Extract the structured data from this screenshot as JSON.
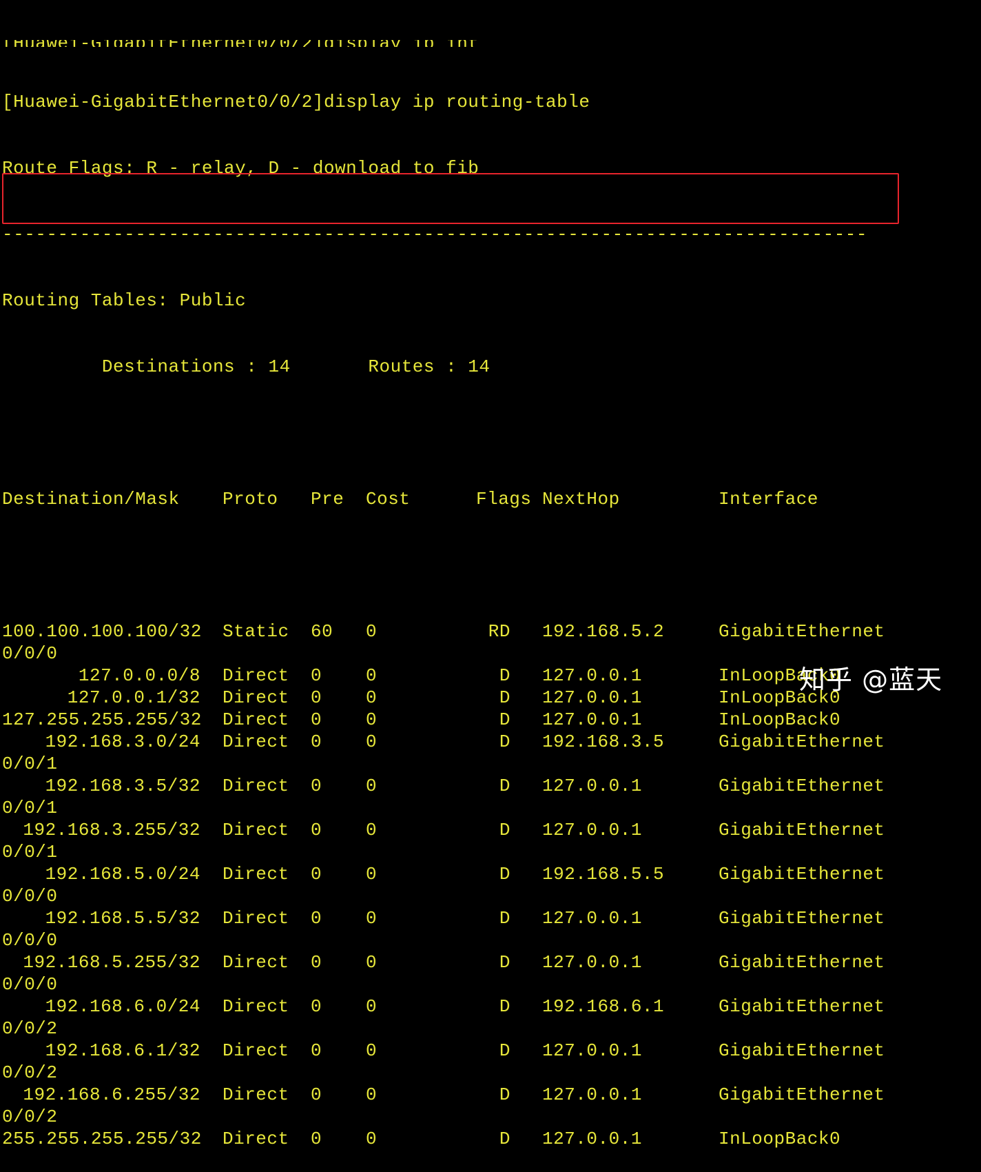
{
  "terminal": {
    "cutoff_line": "[Huawei-GigabitEthernet0/0/2]display ip int",
    "command_line": "[Huawei-GigabitEthernet0/0/2]display ip routing-table",
    "flags_legend": "Route Flags: R - relay, D - download to fib",
    "separator": "------------------------------------------------------------------------------",
    "routing_tables_label": "Routing Tables: Public",
    "summary_line": "         Destinations : 14       Routes : 14",
    "columns": {
      "dest": "Destination/Mask",
      "proto": "Proto",
      "pre": "Pre",
      "cost": "Cost",
      "flags": "Flags",
      "nexthop": "NextHop",
      "iface": "Interface"
    },
    "routes": [
      {
        "dest": "100.100.100.100/32",
        "proto": "Static",
        "pre": "60",
        "cost": "0",
        "flags": "RD",
        "nexthop": "192.168.5.2",
        "iface": "GigabitEthernet",
        "iface_cont": "0/0/0"
      },
      {
        "dest": "127.0.0.0/8",
        "proto": "Direct",
        "pre": "0",
        "cost": "0",
        "flags": "D",
        "nexthop": "127.0.0.1",
        "iface": "InLoopBack0",
        "iface_cont": ""
      },
      {
        "dest": "127.0.0.1/32",
        "proto": "Direct",
        "pre": "0",
        "cost": "0",
        "flags": "D",
        "nexthop": "127.0.0.1",
        "iface": "InLoopBack0",
        "iface_cont": ""
      },
      {
        "dest": "127.255.255.255/32",
        "proto": "Direct",
        "pre": "0",
        "cost": "0",
        "flags": "D",
        "nexthop": "127.0.0.1",
        "iface": "InLoopBack0",
        "iface_cont": ""
      },
      {
        "dest": "192.168.3.0/24",
        "proto": "Direct",
        "pre": "0",
        "cost": "0",
        "flags": "D",
        "nexthop": "192.168.3.5",
        "iface": "GigabitEthernet",
        "iface_cont": "0/0/1"
      },
      {
        "dest": "192.168.3.5/32",
        "proto": "Direct",
        "pre": "0",
        "cost": "0",
        "flags": "D",
        "nexthop": "127.0.0.1",
        "iface": "GigabitEthernet",
        "iface_cont": "0/0/1"
      },
      {
        "dest": "192.168.3.255/32",
        "proto": "Direct",
        "pre": "0",
        "cost": "0",
        "flags": "D",
        "nexthop": "127.0.0.1",
        "iface": "GigabitEthernet",
        "iface_cont": "0/0/1"
      },
      {
        "dest": "192.168.5.0/24",
        "proto": "Direct",
        "pre": "0",
        "cost": "0",
        "flags": "D",
        "nexthop": "192.168.5.5",
        "iface": "GigabitEthernet",
        "iface_cont": "0/0/0"
      },
      {
        "dest": "192.168.5.5/32",
        "proto": "Direct",
        "pre": "0",
        "cost": "0",
        "flags": "D",
        "nexthop": "127.0.0.1",
        "iface": "GigabitEthernet",
        "iface_cont": "0/0/0"
      },
      {
        "dest": "192.168.5.255/32",
        "proto": "Direct",
        "pre": "0",
        "cost": "0",
        "flags": "D",
        "nexthop": "127.0.0.1",
        "iface": "GigabitEthernet",
        "iface_cont": "0/0/0"
      },
      {
        "dest": "192.168.6.0/24",
        "proto": "Direct",
        "pre": "0",
        "cost": "0",
        "flags": "D",
        "nexthop": "192.168.6.1",
        "iface": "GigabitEthernet",
        "iface_cont": "0/0/2"
      },
      {
        "dest": "192.168.6.1/32",
        "proto": "Direct",
        "pre": "0",
        "cost": "0",
        "flags": "D",
        "nexthop": "127.0.0.1",
        "iface": "GigabitEthernet",
        "iface_cont": "0/0/2"
      },
      {
        "dest": "192.168.6.255/32",
        "proto": "Direct",
        "pre": "0",
        "cost": "0",
        "flags": "D",
        "nexthop": "127.0.0.1",
        "iface": "GigabitEthernet",
        "iface_cont": "0/0/2"
      },
      {
        "dest": "255.255.255.255/32",
        "proto": "Direct",
        "pre": "0",
        "cost": "0",
        "flags": "D",
        "nexthop": "127.0.0.1",
        "iface": "InLoopBack0",
        "iface_cont": ""
      }
    ]
  },
  "watermark": "知乎 @蓝天",
  "colors": {
    "background": "#000000",
    "text": "#e6e63a",
    "highlight": "#e8242c"
  }
}
